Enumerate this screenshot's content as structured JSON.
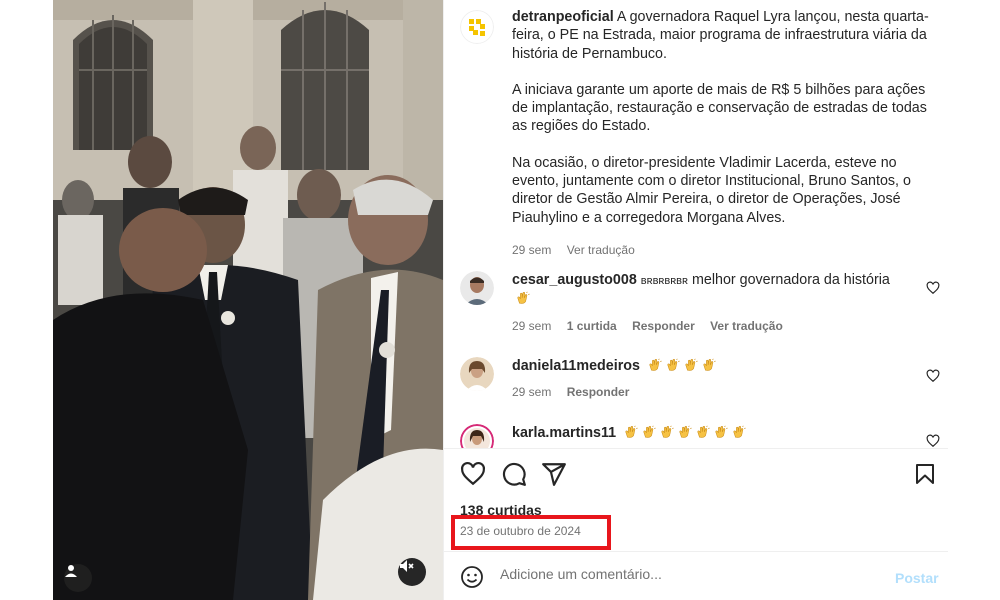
{
  "post": {
    "username": "detranpeoficial",
    "caption_paragraphs": [
      "A governadora Raquel Lyra lançou, nesta quarta-feira, o PE na Estrada, maior programa de infraestrutura viária da história de Pernambuco.",
      "A iniciava garante um aporte de mais de R$ 5 bilhões para ações de implantação, restauração e conservação de estradas de todas as regiões do Estado.",
      "Na ocasião, o diretor-presidente Vladimir Lacerda, esteve no evento, juntamente com o diretor Institucional, Bruno Santos, o diretor de Gestão Almir Pereira, o diretor de Operações, José Piauhylino e a corregedora Morgana Alves."
    ],
    "time": "29 sem",
    "translate": "Ver tradução",
    "brand_color": "#f5c400"
  },
  "comments": [
    {
      "username": "cesar_augusto008",
      "text_prefix": "ʙʀʙʀʙʀʙʀ",
      "text": "melhor governadora da história",
      "claps": 1,
      "time": "29 sem",
      "likes": "1 curtida",
      "reply": "Responder",
      "translate": "Ver tradução"
    },
    {
      "username": "daniela11medeiros",
      "text": "",
      "claps": 4,
      "time": "29 sem",
      "reply": "Responder"
    },
    {
      "username": "karla.martins11",
      "text": "",
      "claps": 7
    }
  ],
  "actions": {
    "likes": "138 curtidas",
    "date": "23 de outubro de 2024",
    "highlight_color": "#e8161c"
  },
  "composer": {
    "placeholder": "Adicione um comentário...",
    "post_label": "Postar"
  },
  "icons": {
    "like": "heart-icon",
    "comment": "comment-icon",
    "share": "share-icon",
    "save": "bookmark-icon",
    "emoji": "emoji-icon",
    "mute": "muted-speaker-icon",
    "tag": "person-icon"
  }
}
